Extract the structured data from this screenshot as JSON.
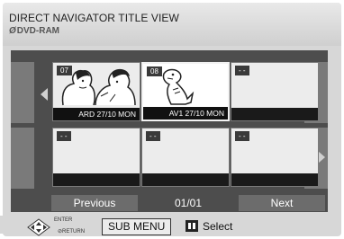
{
  "header": {
    "title": "DIRECT NAVIGATOR  TITLE VIEW",
    "disc_icon": "Ø",
    "disc_type": "DVD-RAM"
  },
  "thumbnails": [
    {
      "number": "07",
      "caption": "ARD 27/10 MON",
      "art": "couple-illustration",
      "selected": false
    },
    {
      "number": "08",
      "caption": "AV1 27/10 MON",
      "art": "dinosaur-illustration",
      "selected": true
    },
    {
      "number": "- -",
      "caption": "",
      "art": "",
      "selected": false
    },
    {
      "number": "- -",
      "caption": "",
      "art": "",
      "selected": false
    },
    {
      "number": "- -",
      "caption": "",
      "art": "",
      "selected": false
    },
    {
      "number": "- -",
      "caption": "",
      "art": "",
      "selected": false
    }
  ],
  "nav": {
    "previous": "Previous",
    "page": "01/01",
    "next": "Next"
  },
  "footer": {
    "enter_label": "ENTER",
    "return_label": "RETURN",
    "submenu_label": "SUB MENU",
    "select_label": "Select"
  },
  "colors": {
    "panel": "#4d4d4d",
    "caption_bg": "#111111",
    "button": "#6c6c6c"
  }
}
